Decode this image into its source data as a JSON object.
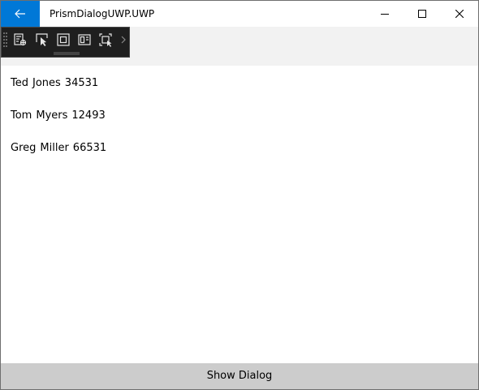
{
  "window": {
    "title": "PrismDialogUWP.UWP",
    "back_icon": "arrow-left-icon",
    "accent": "#0078d7"
  },
  "caption_buttons": [
    "minimize-icon",
    "maximize-icon",
    "close-icon"
  ],
  "dev_toolbar": {
    "tools": [
      "live-visual-tree-icon",
      "select-element-icon",
      "display-layout-adorners-icon",
      "track-focus-icon",
      "display-layout-bounds-icon"
    ],
    "more_icon": "chevron-right-icon"
  },
  "people": [
    {
      "first": "Ted",
      "last": "Jones",
      "id": "34531"
    },
    {
      "first": "Tom",
      "last": "Myers",
      "id": "12493"
    },
    {
      "first": "Greg",
      "last": "Miller",
      "id": "66531"
    }
  ],
  "footer": {
    "show_dialog_label": "Show Dialog"
  }
}
